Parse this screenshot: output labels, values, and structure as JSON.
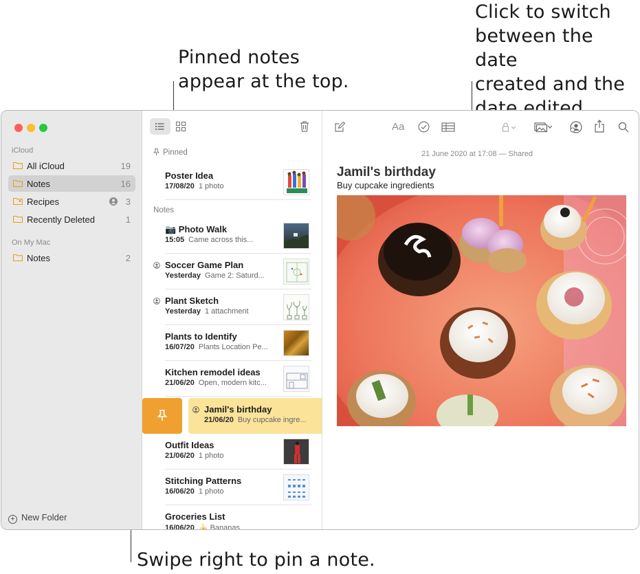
{
  "callouts": {
    "pinned": "Pinned notes\nappear at the top.",
    "date": "Click to switch\nbetween the date\ncreated and the\ndate edited.",
    "swipe": "Swipe right to pin a note."
  },
  "sidebar": {
    "icloud_header": "iCloud",
    "icloud_folders": [
      {
        "name": "All iCloud",
        "count": "19"
      },
      {
        "name": "Notes",
        "count": "16"
      },
      {
        "name": "Recipes",
        "count": "3"
      },
      {
        "name": "Recently Deleted",
        "count": "1"
      }
    ],
    "mac_header": "On My Mac",
    "mac_folders": [
      {
        "name": "Notes",
        "count": "2"
      }
    ],
    "new_folder": "New Folder"
  },
  "list": {
    "pinned_header": "Pinned",
    "notes_header": "Notes",
    "pinned": [
      {
        "title": "Poster Idea",
        "date": "17/08/20",
        "preview": "1 photo"
      }
    ],
    "notes": [
      {
        "title": "📷 Photo Walk",
        "date": "15:05",
        "preview": "Came across this..."
      },
      {
        "title": "Soccer Game Plan",
        "date": "Yesterday",
        "preview": "Game 2: Saturd..."
      },
      {
        "title": "Plant Sketch",
        "date": "Yesterday",
        "preview": "1 attachment"
      },
      {
        "title": "Plants to Identify",
        "date": "16/07/20",
        "preview": "Plants Location Pe..."
      },
      {
        "title": "Kitchen remodel ideas",
        "date": "21/06/20",
        "preview": "Open, modern kitc..."
      },
      {
        "title": "Jamil's birthday",
        "date": "21/06/20",
        "preview": "Buy cupcake ingre..."
      },
      {
        "title": "Outfit Ideas",
        "date": "21/06/20",
        "preview": "1 photo"
      },
      {
        "title": "Stitching Patterns",
        "date": "16/06/20",
        "preview": "1 photo"
      },
      {
        "title": "Groceries List",
        "date": "16/06/20",
        "preview": "🍌 Bananas"
      }
    ]
  },
  "editor": {
    "date_line": "21 June 2020 at 17:08 — Shared",
    "title": "Jamil's birthday",
    "body": "Buy cupcake ingredients",
    "format_label": "Aa"
  },
  "colors": {
    "sidebar_bg": "#e9e9e9",
    "selected_note": "#fbe39a",
    "pin_action": "#f0a030",
    "folder_icon": "#e0a21a"
  }
}
